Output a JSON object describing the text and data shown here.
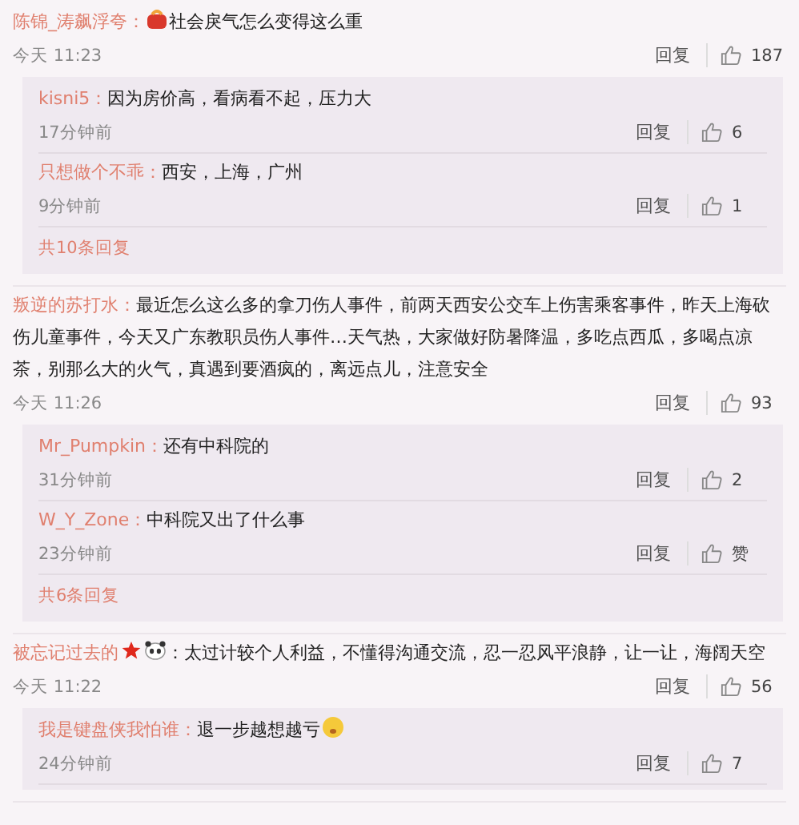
{
  "comments": [
    {
      "user": "陈锦_涛飙浮夸：",
      "badges": [
        {
          "kind": "gift"
        }
      ],
      "text": "社会戾气怎么变得这么重",
      "time": "今天 11:23",
      "reply_label": "回复",
      "likes": "187",
      "replies": [
        {
          "user": "kisni5：",
          "text": "因为房价高，看病看不起，压力大",
          "time": "17分钟前",
          "reply_label": "回复",
          "likes": "6"
        },
        {
          "user": "只想做个不乖：",
          "text": "西安，上海，广州",
          "time": "9分钟前",
          "reply_label": "回复",
          "likes": "1"
        }
      ],
      "more": "共10条回复"
    },
    {
      "user": "叛逆的苏打水：",
      "text": "最近怎么这么多的拿刀伤人事件，前两天西安公交车上伤害乘客事件，昨天上海砍伤儿童事件，今天又广东教职员伤人事件…天气热，大家做好防暑降温，多吃点西瓜，多喝点凉茶，别那么大的火气，真遇到要酒疯的，离远点儿，注意安全",
      "time": "今天 11:26",
      "reply_label": "回复",
      "likes": "93",
      "replies": [
        {
          "user": "Mr_Pumpkin：",
          "text": "还有中科院的",
          "time": "31分钟前",
          "reply_label": "回复",
          "likes": "2"
        },
        {
          "user": "W_Y_Zone：",
          "text": "中科院又出了什么事",
          "time": "23分钟前",
          "reply_label": "回复",
          "likes": "赞"
        }
      ],
      "more": "共6条回复"
    },
    {
      "user": "被忘记过去的",
      "badges": [
        {
          "kind": "star"
        },
        {
          "kind": "panda"
        }
      ],
      "text": "：太过计较个人利益，不懂得沟通交流，忍一忍风平浪静，让一让，海阔天空",
      "time": "今天 11:22",
      "reply_label": "回复",
      "likes": "56",
      "replies": [
        {
          "user": "我是键盘侠我怕谁：",
          "text": "退一步越想越亏",
          "trailing_badges": [
            {
              "kind": "face"
            }
          ],
          "time": "24分钟前",
          "reply_label": "回复",
          "likes": "7"
        }
      ]
    }
  ]
}
